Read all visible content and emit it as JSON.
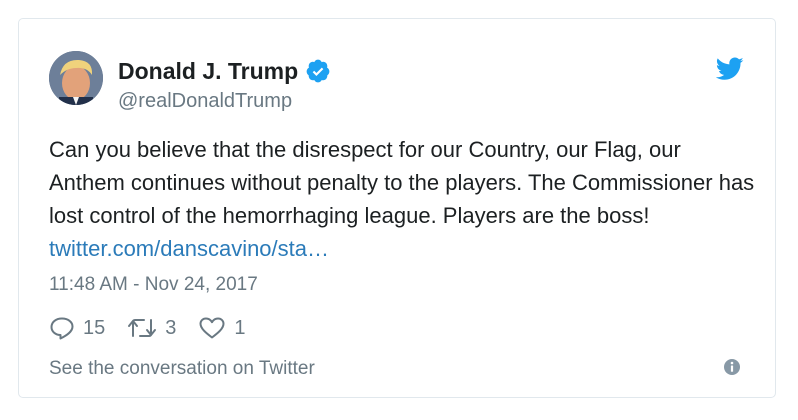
{
  "tweet": {
    "author_name": "Donald J. Trump",
    "author_handle": "@realDonaldTrump",
    "text": "Can you believe that the disrespect for our Country, our Flag, our Anthem continues without penalty to the players. The Commissioner has lost control of the hemorrhaging league. Players are the boss! ",
    "link_text": "twitter.com/danscavino/sta…",
    "timestamp": "11:48 AM - Nov 24, 2017",
    "replies": "15",
    "retweets": "3",
    "likes": "1",
    "footer_text": "See the conversation on Twitter"
  },
  "icons": {
    "verified": "verified-badge-icon",
    "brand": "twitter-bird-icon",
    "reply": "reply-icon",
    "retweet": "retweet-icon",
    "like": "heart-icon",
    "info": "info-icon"
  },
  "colors": {
    "brand_blue": "#1da1f2",
    "link": "#2b7bb9",
    "secondary_text": "#697882",
    "primary_text": "#1c2022",
    "border": "#e1e8ed"
  }
}
